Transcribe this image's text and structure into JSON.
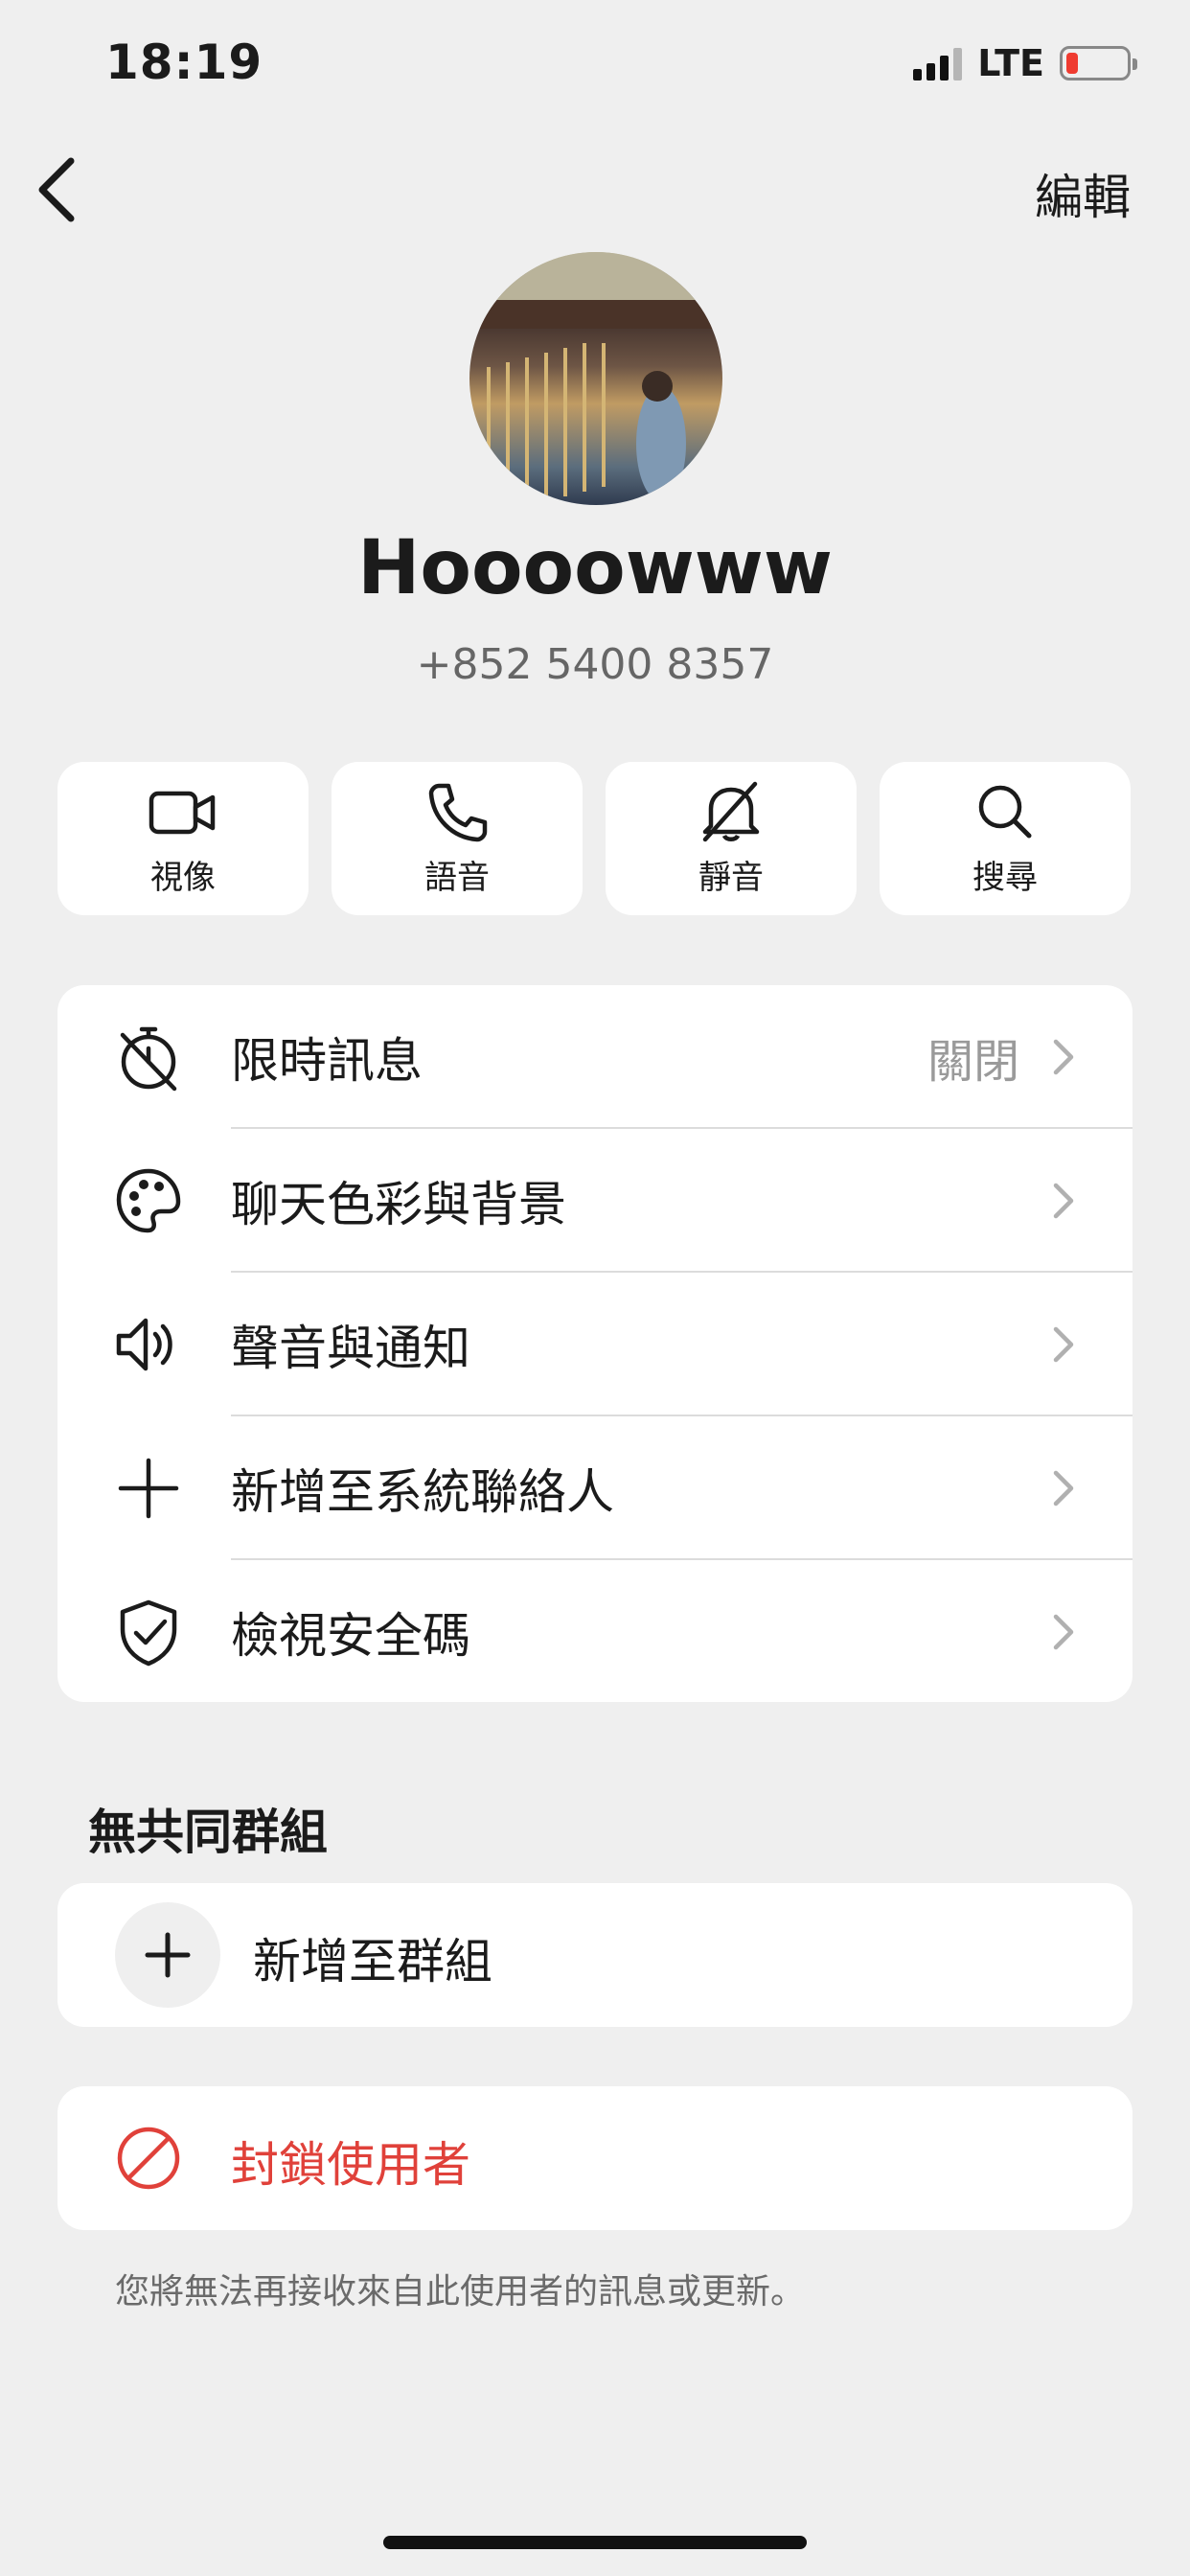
{
  "status_bar": {
    "time": "18:19",
    "network": "LTE",
    "battery_level": 0.12,
    "battery_color": "#ef3b30"
  },
  "nav": {
    "edit_label": "編輯"
  },
  "profile": {
    "name": "Hoooowww",
    "phone": "+852 5400 8357"
  },
  "actions": [
    {
      "label": "視像",
      "icon": "video-icon"
    },
    {
      "label": "語音",
      "icon": "phone-icon"
    },
    {
      "label": "靜音",
      "icon": "bell-off-icon"
    },
    {
      "label": "搜尋",
      "icon": "search-icon"
    }
  ],
  "menu": [
    {
      "label": "限時訊息",
      "value": "關閉",
      "icon": "timer-off-icon"
    },
    {
      "label": "聊天色彩與背景",
      "icon": "palette-icon"
    },
    {
      "label": "聲音與通知",
      "icon": "speaker-icon"
    },
    {
      "label": "新增至系統聯絡人",
      "icon": "plus-icon"
    },
    {
      "label": "檢視安全碼",
      "icon": "shield-check-icon"
    }
  ],
  "groups": {
    "title": "無共同群組",
    "add_label": "新增至群組"
  },
  "block": {
    "label": "封鎖使用者",
    "note": "您將無法再接收來自此使用者的訊息或更新。",
    "color": "#e0413a"
  }
}
